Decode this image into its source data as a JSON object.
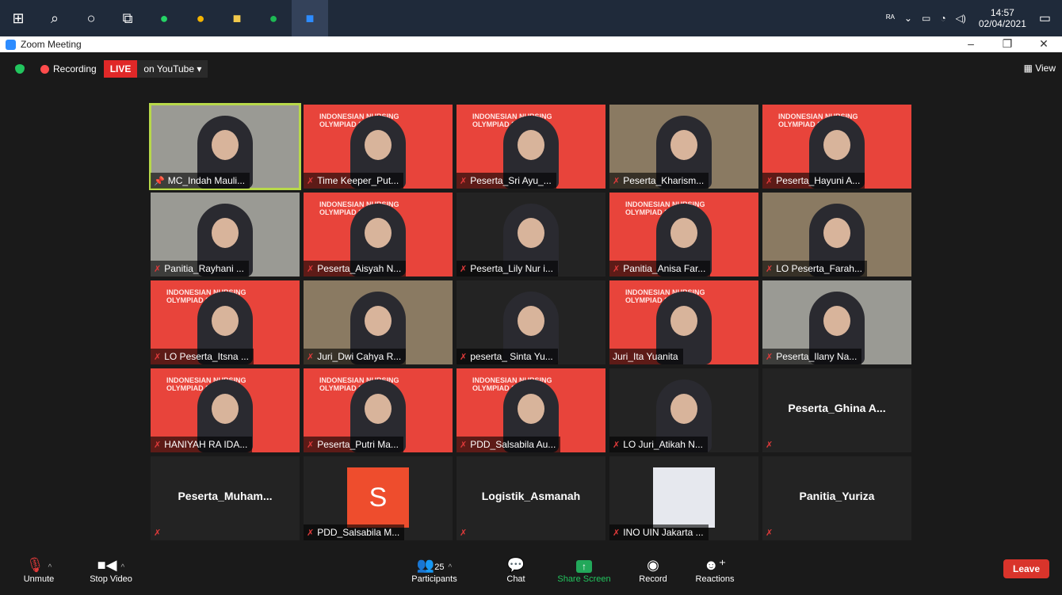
{
  "taskbar": {
    "apps": [
      {
        "name": "windows-icon",
        "glyph": "⊞",
        "color": "#ffffff"
      },
      {
        "name": "search-icon",
        "glyph": "⌕",
        "color": "#ffffff"
      },
      {
        "name": "cortana-icon",
        "glyph": "○",
        "color": "#ffffff"
      },
      {
        "name": "task-view-icon",
        "glyph": "⧉",
        "color": "#ffffff"
      },
      {
        "name": "whatsapp-icon",
        "glyph": "●",
        "color": "#25d366"
      },
      {
        "name": "chrome-icon",
        "glyph": "●",
        "color": "#f4b400"
      },
      {
        "name": "file-explorer-icon",
        "glyph": "■",
        "color": "#f2c94c"
      },
      {
        "name": "spotify-icon",
        "glyph": "●",
        "color": "#1db954"
      },
      {
        "name": "zoom-icon",
        "glyph": "■",
        "color": "#2d8cff"
      }
    ],
    "time": "14:57",
    "date": "02/04/2021"
  },
  "window": {
    "title": "Zoom Meeting"
  },
  "meeting": {
    "recording_label": "Recording",
    "live_label": "LIVE",
    "stream_label": "on YouTube ▾",
    "view_label": "View"
  },
  "tiles": [
    {
      "name": "MC_Indah Mauli...",
      "style": "gray",
      "video": true,
      "pinned": true,
      "active": true
    },
    {
      "name": "Time Keeper_Put...",
      "style": "red",
      "video": true
    },
    {
      "name": "Peserta_Sri Ayu_...",
      "style": "red",
      "video": true
    },
    {
      "name": "Peserta_Kharism...",
      "style": "room",
      "video": true
    },
    {
      "name": "Peserta_Hayuni A...",
      "style": "red",
      "video": true
    },
    {
      "name": "Panitia_Rayhani ...",
      "style": "gray",
      "video": true
    },
    {
      "name": "Peserta_Aisyah N...",
      "style": "red",
      "video": true
    },
    {
      "name": "Peserta_Lily Nur i...",
      "style": "black",
      "video": true
    },
    {
      "name": "Panitia_Anisa Far...",
      "style": "red",
      "video": true
    },
    {
      "name": "LO Peserta_Farah...",
      "style": "room",
      "video": true
    },
    {
      "name": "LO Peserta_Itsna ...",
      "style": "red",
      "video": true
    },
    {
      "name": "Juri_Dwi Cahya R...",
      "style": "room",
      "video": true
    },
    {
      "name": "peserta_ Sinta Yu...",
      "style": "black",
      "video": true
    },
    {
      "name": "Juri_Ita Yuanita",
      "style": "red",
      "video": true,
      "nomute": true
    },
    {
      "name": "Peserta_Ilany Na...",
      "style": "gray",
      "video": true
    },
    {
      "name": "HANIYAH RA IDA...",
      "style": "red",
      "video": true
    },
    {
      "name": "Peserta_Putri Ma...",
      "style": "red",
      "video": true
    },
    {
      "name": "PDD_Salsabila Au...",
      "style": "red",
      "video": true
    },
    {
      "name": "LO Juri_Atikah N...",
      "style": "black",
      "video": true
    },
    {
      "name": "Peserta_Ghina A...",
      "style": "black",
      "big": true
    },
    {
      "name": "Peserta_Muham...",
      "style": "black",
      "big": true
    },
    {
      "name": "PDD_Salsabila M...",
      "style": "black",
      "avatar": "S"
    },
    {
      "name": "Logistik_Asmanah",
      "style": "black",
      "big": true
    },
    {
      "name": "INO UIN Jakarta ...",
      "style": "black",
      "blur": true
    },
    {
      "name": "Panitia_Yuriza",
      "style": "black",
      "big": true
    }
  ],
  "banner_text": "INDONESIAN NURSING OLYMPIAD 2021",
  "toolbar": {
    "unmute": "Unmute",
    "stop_video": "Stop Video",
    "participants": "Participants",
    "participants_count": "25",
    "chat": "Chat",
    "share_screen": "Share Screen",
    "record": "Record",
    "reactions": "Reactions",
    "leave": "Leave"
  },
  "colors": {
    "accent": "#2d8cff",
    "live": "#e02828",
    "share": "#22a85a",
    "leave": "#d9342b",
    "active_border": "#b8d94a"
  }
}
